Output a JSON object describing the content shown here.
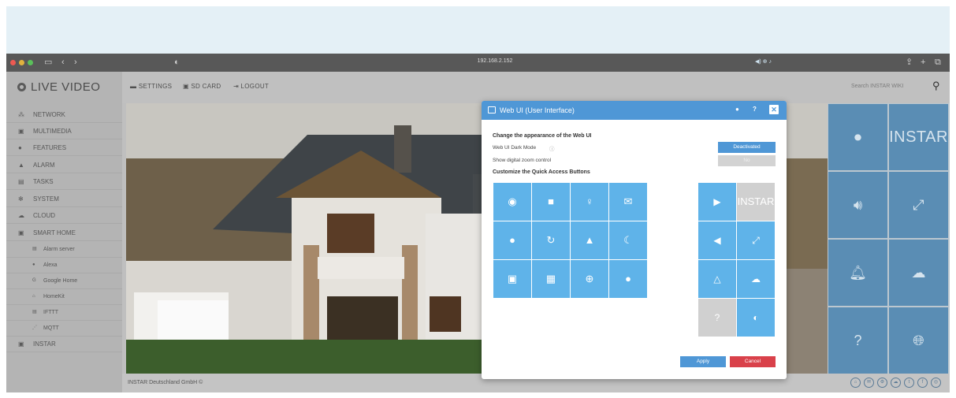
{
  "browser": {
    "url": "192.168.2.152",
    "url_right_indicator": "◀) ⊕ ♪"
  },
  "nav": {
    "logo": "LIVE VIDEO",
    "items": [
      {
        "label": "NETWORK",
        "icon": "network-icon"
      },
      {
        "label": "MULTIMEDIA",
        "icon": "image-icon"
      },
      {
        "label": "FEATURES",
        "icon": "dot-icon"
      },
      {
        "label": "ALARM",
        "icon": "bell-icon"
      },
      {
        "label": "TASKS",
        "icon": "film-icon"
      },
      {
        "label": "SYSTEM",
        "icon": "gear-icon"
      },
      {
        "label": "CLOUD",
        "icon": "cloud-icon"
      },
      {
        "label": "SMART HOME",
        "icon": "smarthome-icon"
      },
      {
        "label": "Alarm server",
        "icon": "server-icon"
      },
      {
        "label": "Alexa",
        "icon": "chat-icon"
      },
      {
        "label": "Google Home",
        "icon": "google-icon"
      },
      {
        "label": "HomeKit",
        "icon": "home-icon"
      },
      {
        "label": "IFTTT",
        "icon": "ifttt-icon"
      },
      {
        "label": "MQTT",
        "icon": "rss-icon"
      },
      {
        "label": "INSTAR",
        "icon": "instar-icon"
      }
    ]
  },
  "topmenu": {
    "settings": "SETTINGS",
    "sdcard": "SD CARD",
    "logout": "LOGOUT",
    "search_placeholder": "Search INSTAR WIKI"
  },
  "footer": {
    "text": "INSTAR Deutschland GmbH ©"
  },
  "right_grid": {
    "brand": "INSTAR"
  },
  "dialog": {
    "title": "Web UI (User Interface)",
    "section1": "Change the appearance of the Web UI",
    "darkmode_label": "Web UI Dark Mode",
    "darkmode_value": "Deactivated",
    "zoom_label": "Show digital zoom control",
    "zoom_value": "No",
    "section2": "Customize the Quick Access Buttons",
    "right_brand": "INSTAR",
    "apply": "Apply",
    "cancel": "Cancel"
  },
  "colors": {
    "accent": "#4f97d6",
    "tile": "#5fb3e9",
    "cancel": "#d9414a"
  }
}
